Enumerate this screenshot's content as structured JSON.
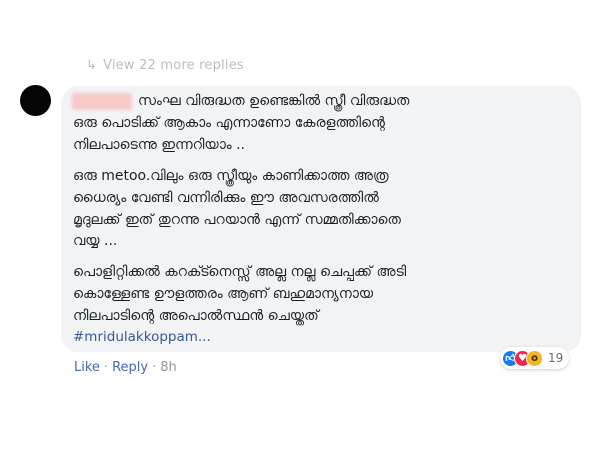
{
  "thread": {
    "view_more_replies": "View 22 more replies"
  },
  "comment": {
    "body_lines": [
      "സംഘ വിരുദ്ധത ഉണ്ടെങ്കിൽ സ്ത്രീ വിരുദ്ധത",
      "ഒരു പൊടിക്ക് ആകാം എന്നാണോ കേരളത്തിന്റെ",
      "നിലപാടെന്നു ഇന്നറിയാം ..",
      "ഒരു metoo.വിലും ഒരു സ്ത്രീയും കാണിക്കാത്ത അത്ര",
      "ധൈര്യം വേണ്ടി വന്നിരിക്കും ഈ അവസരത്തിൽ",
      "മൃദുലക്ക് ഇത് തുറന്നു പറയാൻ എന്ന് സമ്മതിക്കാതെ",
      "വയ്യ ...",
      "പൊളിറ്റിക്കൽ കറക്ട്നെസ്സ് അല്ല നല്ല ചെപ്പക്ക് അടി",
      "കൊള്ളേണ്ട ഊളത്തരം ആണ് ബഹുമാന്യനായ",
      "നിലപാടിന്റെ അപൊൽസ്ഥൻ ചെയ്തത്"
    ],
    "hashtag": "#mridulakkoppam...",
    "reactions": {
      "icons": [
        "like-icon",
        "love-icon",
        "wow-icon"
      ],
      "count": "19"
    },
    "actions": {
      "like_label": "Like",
      "separator": "·",
      "reply_label": "Reply",
      "time": "8h"
    }
  },
  "colors": {
    "bubble": "#f2f3f5",
    "link": "#385898",
    "like": "#1877f2",
    "love": "#f02849",
    "wow": "#f7b125"
  }
}
